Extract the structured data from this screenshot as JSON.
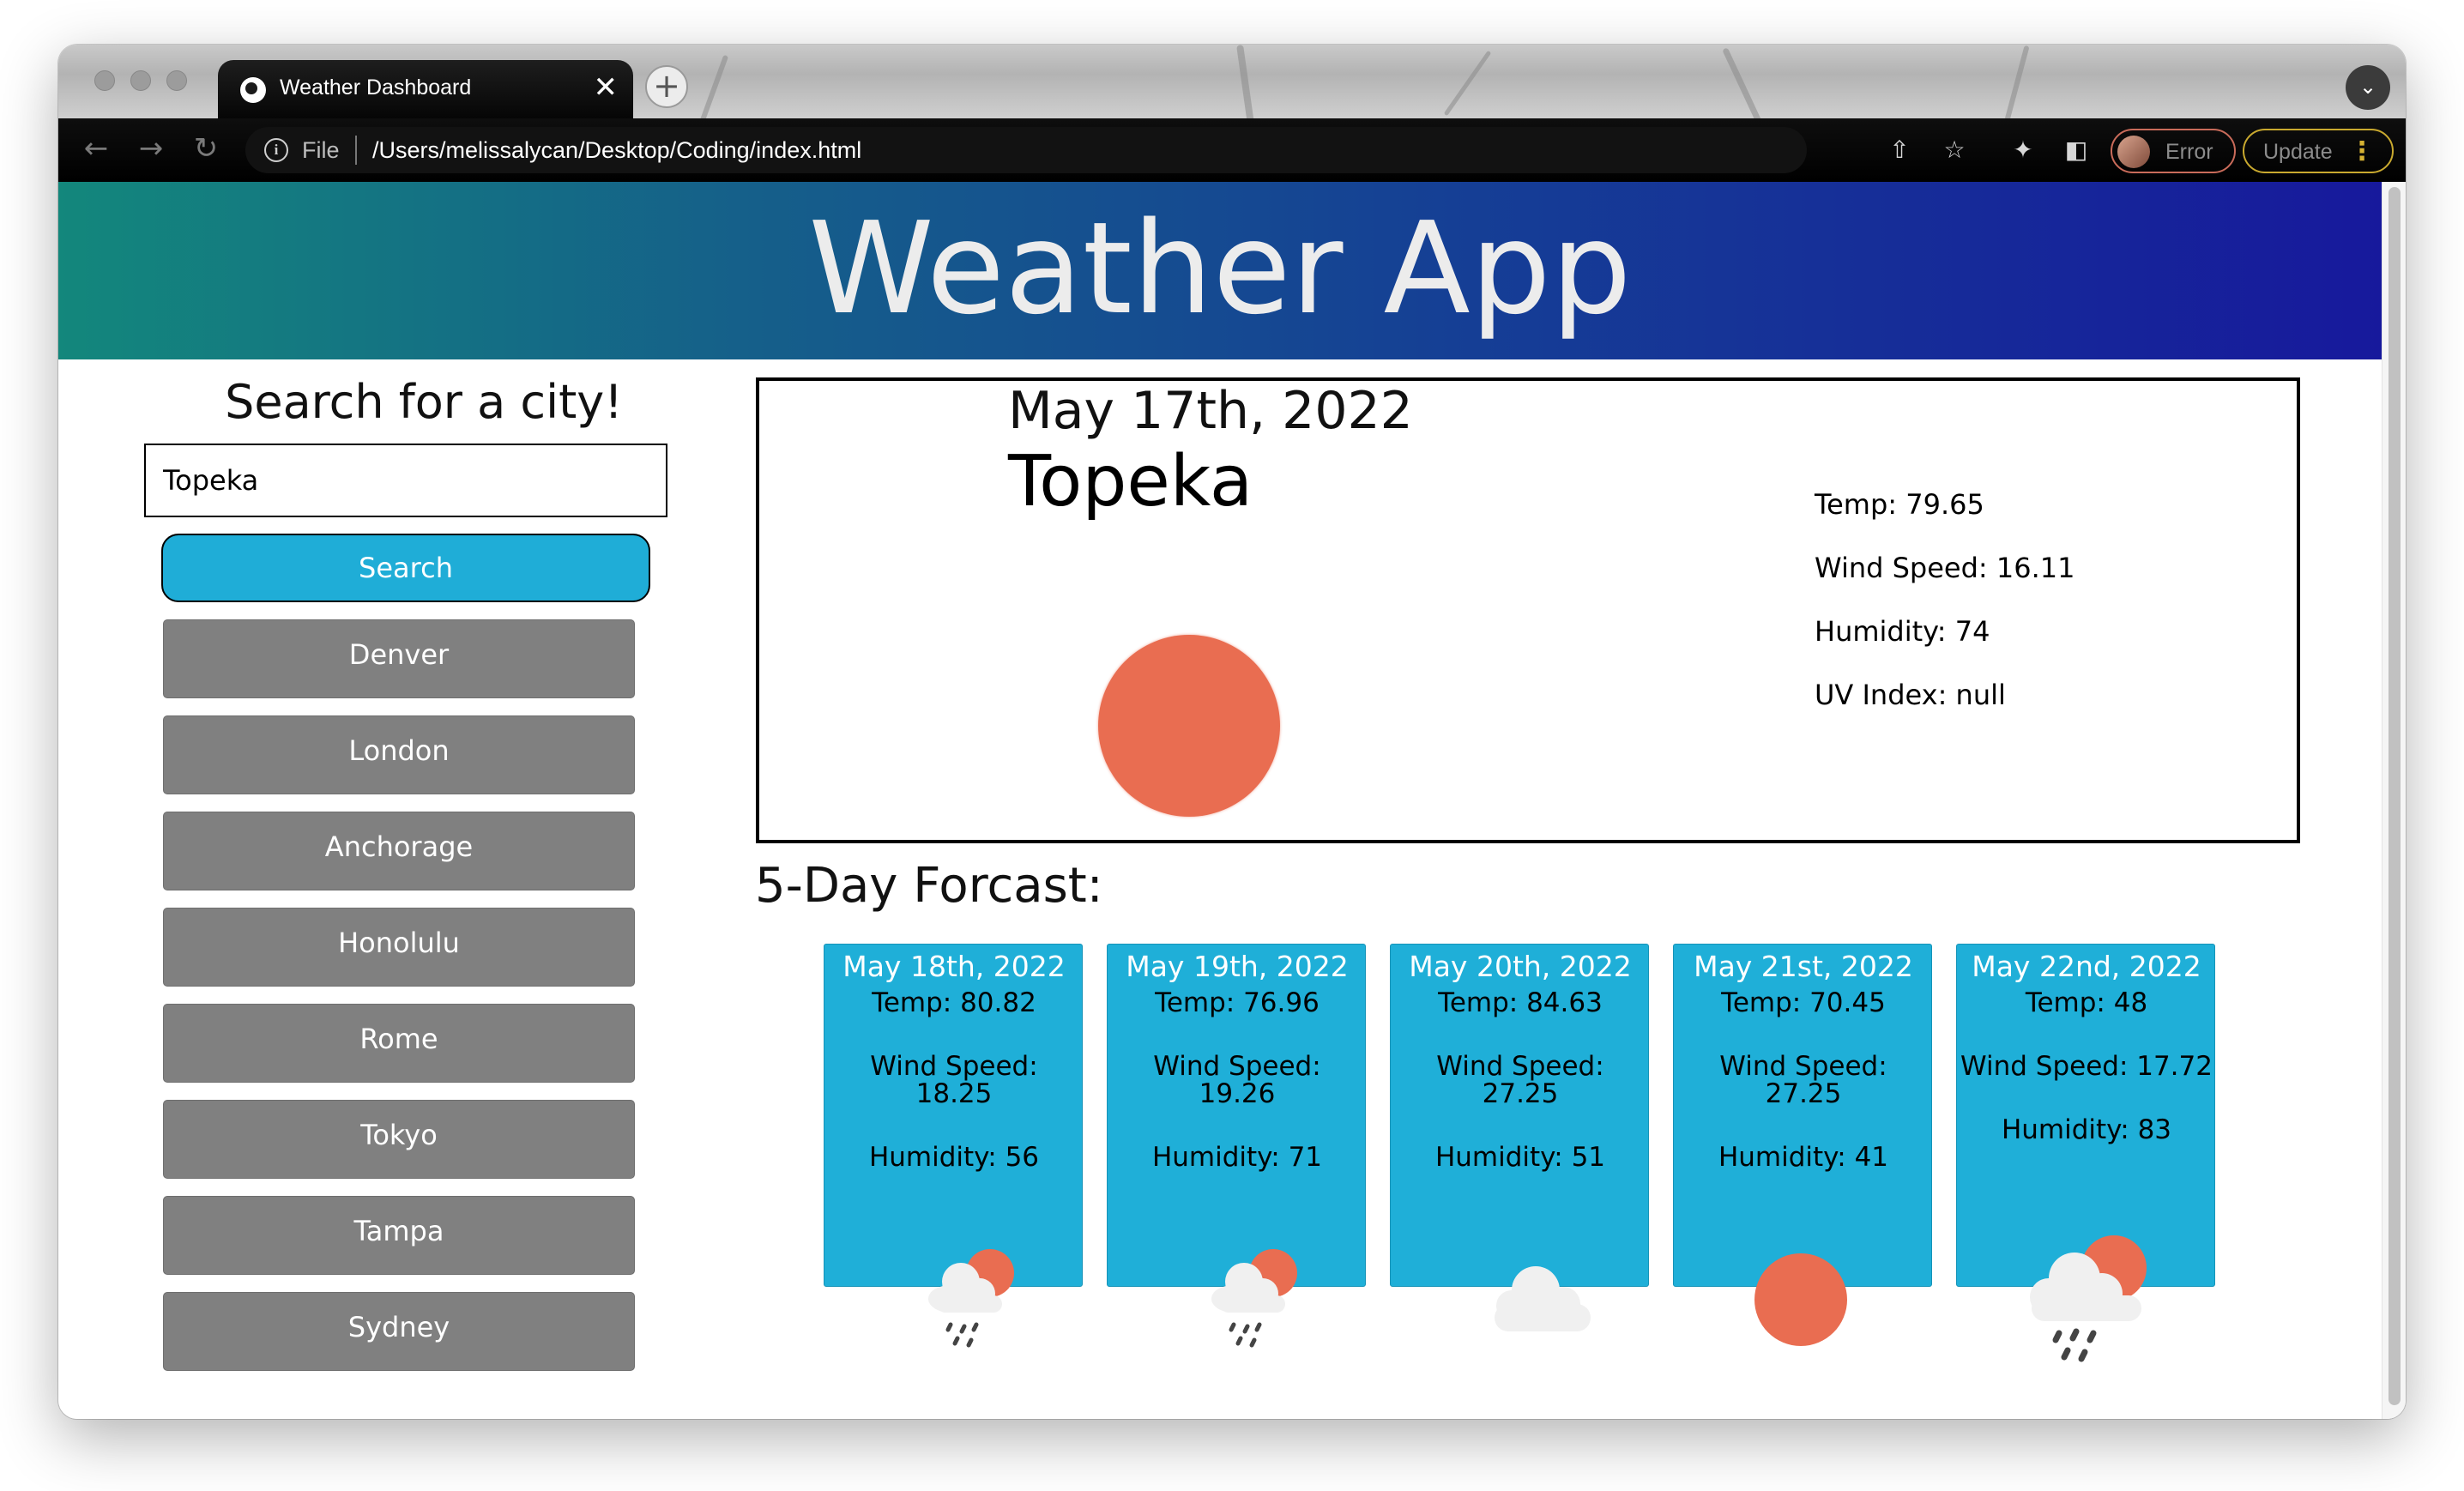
{
  "browser": {
    "tab_title": "Weather Dashboard",
    "tab_close": "✕",
    "new_tab": "+",
    "url_scheme": "File",
    "url": "/Users/melissalycan/Desktop/Coding/index.html",
    "profile_label": "Error",
    "update_label": "Update"
  },
  "app": {
    "title": "Weather App"
  },
  "sidebar": {
    "heading": "Search for a city!",
    "search_value": "Topeka",
    "search_button": "Search",
    "cities": [
      "Denver",
      "London",
      "Anchorage",
      "Honolulu",
      "Rome",
      "Tokyo",
      "Tampa",
      "Sydney"
    ]
  },
  "current": {
    "date": "May 17th, 2022",
    "city": "Topeka",
    "icon": "sun-icon",
    "temp": "Temp: 79.65",
    "wind": "Wind Speed: 16.11",
    "humidity": "Humidity: 74",
    "uv": "UV Index: null"
  },
  "forecast": {
    "heading": "5-Day Forcast:",
    "days": [
      {
        "date": "May 18th, 2022",
        "temp": "Temp: 80.82",
        "wind_label": "Wind Speed:",
        "wind_value": "18.25",
        "humidity": "Humidity: 56",
        "icon": "rain-sun-icon"
      },
      {
        "date": "May 19th, 2022",
        "temp": "Temp: 76.96",
        "wind_label": "Wind Speed:",
        "wind_value": "19.26",
        "humidity": "Humidity: 71",
        "icon": "rain-sun-icon"
      },
      {
        "date": "May 20th, 2022",
        "temp": "Temp: 84.63",
        "wind_label": "Wind Speed:",
        "wind_value": "27.25",
        "humidity": "Humidity: 51",
        "icon": "cloud-icon"
      },
      {
        "date": "May 21st, 2022",
        "temp": "Temp: 70.45",
        "wind_label": "Wind Speed:",
        "wind_value": "27.25",
        "humidity": "Humidity: 41",
        "icon": "sun-icon"
      },
      {
        "date": "May 22nd, 2022",
        "temp": "Temp: 48",
        "wind_label": "Wind Speed: 17.72",
        "wind_value": "",
        "humidity": "Humidity: 83",
        "icon": "rain-sun-icon"
      }
    ]
  },
  "colors": {
    "header_gradient": [
      "#13877c",
      "#17199c"
    ],
    "search_button": "#1fadd7",
    "city_button": "#808080",
    "card": "#1fafd8",
    "sun": "#e96d51"
  }
}
